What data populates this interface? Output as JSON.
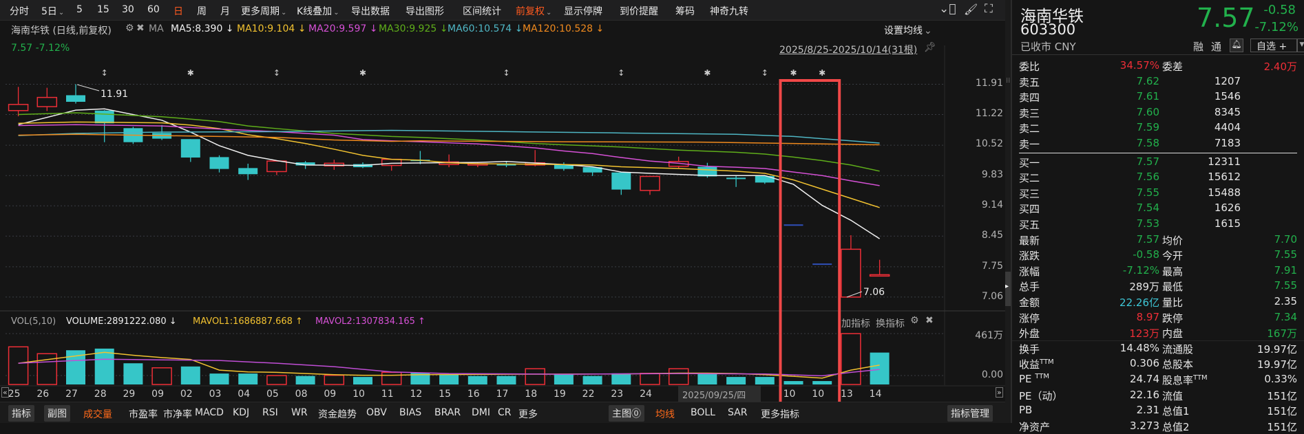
{
  "toolbar": {
    "items": [
      "分时",
      "5日",
      "5",
      "15",
      "30",
      "60",
      "日",
      "周",
      "月",
      "更多周期",
      "K线叠加",
      "导出数据",
      "导出图形",
      "区间统计",
      "前复权",
      "显示停牌",
      "到价提醒",
      "筹码",
      "神奇九转"
    ],
    "active": [
      "日",
      "前复权"
    ]
  },
  "legend": {
    "title": "海南华铁 (日线,前复权)",
    "ma_label": "MA",
    "ma5": "MA5:8.390 ↓",
    "ma10": "MA10:9.104 ↓",
    "ma20": "MA20:9.597 ↓",
    "ma30": "MA30:9.925 ↓",
    "ma60": "MA60:10.574 ↓",
    "ma120": "MA120:10.528 ↓",
    "set_ma": "设置均线",
    "price_change": "7.57  -7.12%",
    "range": "2025/8/25-2025/10/14(31根)"
  },
  "colors": {
    "up": "#ee2e37",
    "down": "#36c6c8",
    "limit": "#2f4fb8",
    "ma5": "#f0f0f0",
    "ma10": "#f2c230",
    "ma20": "#d651d6",
    "ma30": "#5fae1a",
    "ma60": "#4fb6c4",
    "ma120": "#f08a1e",
    "mavol1": "#f2c230",
    "mavol2": "#c04ed6",
    "highlight": "#f04848"
  },
  "vol_legend": {
    "name": "VOL(5,10)",
    "volume": "VOLUME:2891222.080 ↓",
    "mavol1": "MAVOL1:1686887.668 ↑",
    "mavol2": "MAVOL2:1307834.165 ↑",
    "add": "加指标",
    "switch": "换指标"
  },
  "annotations": {
    "high": "11.91",
    "low": "7.06"
  },
  "tooltip_date": "2025/09/25/四",
  "chart_data": {
    "type": "candlestick",
    "price_axis": [
      "11.91",
      "11.22",
      "10.52",
      "9.83",
      "9.14",
      "8.45",
      "7.75",
      "7.06"
    ],
    "price_range": [
      7.06,
      11.91
    ],
    "vol_axis": [
      "461万",
      "0.00"
    ],
    "vol_max": 461,
    "date_labels": [
      "25",
      "26",
      "27",
      "28",
      "29",
      "09",
      "02",
      "03",
      "04",
      "05",
      "08",
      "09",
      "10",
      "11",
      "12",
      "15",
      "16",
      "17",
      "18",
      "19",
      "22",
      "23",
      "24",
      "",
      "",
      "",
      "",
      "10",
      "10",
      "13",
      "14"
    ],
    "ohlcv": [
      [
        11.31,
        11.85,
        11.18,
        11.45,
        341
      ],
      [
        11.4,
        11.83,
        11.3,
        11.61,
        279
      ],
      [
        11.66,
        11.91,
        11.47,
        11.51,
        310
      ],
      [
        11.31,
        11.32,
        10.59,
        11.02,
        325
      ],
      [
        10.91,
        10.94,
        10.55,
        10.59,
        192
      ],
      [
        10.8,
        10.98,
        10.64,
        10.67,
        151
      ],
      [
        10.66,
        10.66,
        10.14,
        10.24,
        163
      ],
      [
        10.25,
        10.29,
        9.9,
        9.98,
        99
      ],
      [
        10.0,
        10.1,
        9.73,
        9.86,
        99
      ],
      [
        9.92,
        10.16,
        9.84,
        10.16,
        81
      ],
      [
        10.13,
        10.16,
        9.98,
        10.06,
        77
      ],
      [
        10.05,
        10.19,
        9.96,
        10.11,
        83
      ],
      [
        10.09,
        10.13,
        10.0,
        10.02,
        68
      ],
      [
        10.06,
        10.2,
        9.94,
        10.2,
        110
      ],
      [
        10.19,
        10.39,
        10.09,
        10.16,
        105
      ],
      [
        10.08,
        10.31,
        10.02,
        10.14,
        93
      ],
      [
        10.08,
        10.13,
        10.02,
        10.1,
        77
      ],
      [
        10.09,
        10.16,
        10.02,
        10.06,
        77
      ],
      [
        10.07,
        10.41,
        10.04,
        10.12,
        143
      ],
      [
        10.08,
        10.13,
        9.94,
        9.98,
        93
      ],
      [
        10.02,
        10.02,
        9.82,
        9.9,
        77
      ],
      [
        9.9,
        9.9,
        9.39,
        9.51,
        101
      ],
      [
        9.49,
        9.81,
        9.39,
        9.81,
        101
      ],
      [
        10.04,
        10.26,
        10.0,
        10.15,
        143
      ],
      [
        10.03,
        10.12,
        9.78,
        9.81,
        95
      ],
      [
        9.78,
        9.83,
        9.57,
        9.75,
        68
      ],
      [
        9.82,
        9.82,
        9.64,
        9.67,
        68
      ],
      [
        8.7,
        8.7,
        8.7,
        8.7,
        31
      ],
      [
        7.81,
        7.81,
        7.81,
        7.81,
        31
      ],
      [
        7.06,
        8.47,
        7.06,
        8.15,
        461
      ],
      [
        7.55,
        7.91,
        7.55,
        7.57,
        289
      ]
    ],
    "ma_lines": [
      {
        "name": "MA5",
        "color": "#f0f0f0",
        "points": [
          [
            0,
            10.99
          ],
          [
            2,
            11.32
          ],
          [
            3,
            11.35
          ],
          [
            5,
            11.09
          ],
          [
            6,
            10.82
          ],
          [
            7,
            10.51
          ],
          [
            8,
            10.29
          ],
          [
            9,
            10.17
          ],
          [
            10,
            10.07
          ],
          [
            12,
            10.06
          ],
          [
            13,
            10.11
          ],
          [
            16,
            10.13
          ],
          [
            17,
            10.15
          ],
          [
            19,
            10.08
          ],
          [
            20,
            10.03
          ],
          [
            21,
            9.91
          ],
          [
            22,
            9.88
          ],
          [
            24,
            9.83
          ],
          [
            26,
            9.83
          ],
          [
            27,
            9.63
          ],
          [
            28,
            9.15
          ],
          [
            29,
            8.81
          ],
          [
            30,
            8.39
          ]
        ]
      },
      {
        "name": "MA10",
        "color": "#f2c230",
        "points": [
          [
            0,
            11.02
          ],
          [
            2,
            11.05
          ],
          [
            5,
            11.03
          ],
          [
            6,
            10.98
          ],
          [
            7,
            10.9
          ],
          [
            8,
            10.76
          ],
          [
            9,
            10.67
          ],
          [
            10,
            10.56
          ],
          [
            11,
            10.43
          ],
          [
            12,
            10.29
          ],
          [
            13,
            10.2
          ],
          [
            14,
            10.18
          ],
          [
            15,
            10.12
          ],
          [
            16,
            10.1
          ],
          [
            19,
            10.08
          ],
          [
            20,
            10.07
          ],
          [
            21,
            10.03
          ],
          [
            22,
            10.01
          ],
          [
            23,
            9.99
          ],
          [
            24,
            9.96
          ],
          [
            25,
            9.93
          ],
          [
            26,
            9.88
          ],
          [
            27,
            9.73
          ],
          [
            28,
            9.52
          ],
          [
            29,
            9.31
          ],
          [
            30,
            9.1
          ]
        ]
      },
      {
        "name": "MA20",
        "color": "#d651d6",
        "points": [
          [
            0,
            10.97
          ],
          [
            2,
            10.99
          ],
          [
            5,
            10.96
          ],
          [
            7,
            10.89
          ],
          [
            9,
            10.83
          ],
          [
            11,
            10.75
          ],
          [
            12,
            10.65
          ],
          [
            13,
            10.62
          ],
          [
            14,
            10.6
          ],
          [
            16,
            10.55
          ],
          [
            18,
            10.46
          ],
          [
            19,
            10.39
          ],
          [
            20,
            10.33
          ],
          [
            21,
            10.24
          ],
          [
            22,
            10.16
          ],
          [
            23,
            10.11
          ],
          [
            24,
            10.04
          ],
          [
            25,
            10.02
          ],
          [
            26,
            9.99
          ],
          [
            27,
            9.91
          ],
          [
            28,
            9.83
          ],
          [
            29,
            9.71
          ],
          [
            30,
            9.6
          ]
        ]
      },
      {
        "name": "MA30",
        "color": "#5fae1a",
        "points": [
          [
            0,
            11.22
          ],
          [
            2,
            11.26
          ],
          [
            5,
            11.17
          ],
          [
            7,
            11.06
          ],
          [
            8,
            10.96
          ],
          [
            9,
            10.9
          ],
          [
            11,
            10.79
          ],
          [
            13,
            10.72
          ],
          [
            14,
            10.7
          ],
          [
            16,
            10.64
          ],
          [
            18,
            10.56
          ],
          [
            19,
            10.53
          ],
          [
            21,
            10.48
          ],
          [
            23,
            10.41
          ],
          [
            25,
            10.36
          ],
          [
            26,
            10.32
          ],
          [
            27,
            10.25
          ],
          [
            28,
            10.17
          ],
          [
            29,
            10.07
          ],
          [
            30,
            9.93
          ]
        ]
      },
      {
        "name": "MA60",
        "color": "#4fb6c4",
        "points": [
          [
            0,
            10.74
          ],
          [
            2,
            10.79
          ],
          [
            5,
            10.82
          ],
          [
            9,
            10.83
          ],
          [
            13,
            10.86
          ],
          [
            17,
            10.83
          ],
          [
            21,
            10.8
          ],
          [
            25,
            10.77
          ],
          [
            27,
            10.72
          ],
          [
            28,
            10.67
          ],
          [
            29,
            10.62
          ],
          [
            30,
            10.57
          ]
        ]
      },
      {
        "name": "MA120",
        "color": "#f08a1e",
        "points": [
          [
            0,
            10.75
          ],
          [
            2,
            10.77
          ],
          [
            5,
            10.74
          ],
          [
            9,
            10.7
          ],
          [
            11,
            10.64
          ],
          [
            13,
            10.61
          ],
          [
            14,
            10.62
          ],
          [
            19,
            10.6
          ],
          [
            24,
            10.59
          ],
          [
            27,
            10.56
          ],
          [
            29,
            10.54
          ],
          [
            30,
            10.53
          ]
        ]
      }
    ],
    "vol_ma_lines": [
      {
        "name": "MAVOL1",
        "color": "#f2c230",
        "points": [
          [
            0,
            192
          ],
          [
            3,
            291
          ],
          [
            4,
            265
          ],
          [
            5,
            244
          ],
          [
            6,
            227
          ],
          [
            7,
            130
          ],
          [
            8,
            114
          ],
          [
            9,
            110
          ],
          [
            11,
            89
          ],
          [
            12,
            83
          ],
          [
            13,
            83
          ],
          [
            14,
            89
          ],
          [
            17,
            93
          ],
          [
            21,
            95
          ],
          [
            23,
            103
          ],
          [
            24,
            103
          ],
          [
            25,
            99
          ],
          [
            26,
            89
          ],
          [
            27,
            74
          ],
          [
            28,
            58
          ],
          [
            29,
            130
          ],
          [
            30,
            176
          ]
        ]
      },
      {
        "name": "MAVOL2",
        "color": "#c04ed6",
        "points": [
          [
            0,
            192
          ],
          [
            2,
            217
          ],
          [
            3,
            229
          ],
          [
            5,
            223
          ],
          [
            7,
            217
          ],
          [
            9,
            192
          ],
          [
            11,
            161
          ],
          [
            13,
            114
          ],
          [
            15,
            99
          ],
          [
            19,
            93
          ],
          [
            23,
            99
          ],
          [
            26,
            95
          ],
          [
            28,
            79
          ],
          [
            29,
            110
          ],
          [
            30,
            136
          ]
        ]
      }
    ],
    "markers": [
      {
        "index": 3,
        "type": "↕"
      },
      {
        "index": 6,
        "type": "✱"
      },
      {
        "index": 9,
        "type": "↕"
      },
      {
        "index": 12,
        "type": "✱"
      },
      {
        "index": 17,
        "type": "↕"
      },
      {
        "index": 21,
        "type": "↕"
      },
      {
        "index": 24,
        "type": "✱"
      },
      {
        "index": 26,
        "type": "↕"
      },
      {
        "index": 27,
        "type": "✱"
      },
      {
        "index": 28,
        "type": "✱"
      }
    ],
    "highlight_range": [
      27,
      28
    ]
  },
  "quote": {
    "name": "海南华铁",
    "code": "603300",
    "status": "已收市 CNY",
    "price": "7.57",
    "change": "-0.58",
    "pct": "-7.12%",
    "margin": "融",
    "connect": "通",
    "watchlist": "自选 +"
  },
  "order_book": {
    "ratio": {
      "l1": "委比",
      "v1": "34.57%",
      "l2": "委差",
      "v2": "2.40万"
    },
    "asks": [
      [
        "卖五",
        "7.62",
        "1207"
      ],
      [
        "卖四",
        "7.61",
        "1546"
      ],
      [
        "卖三",
        "7.60",
        "8345"
      ],
      [
        "卖二",
        "7.59",
        "4404"
      ],
      [
        "卖一",
        "7.58",
        "7183"
      ]
    ],
    "bids": [
      [
        "买一",
        "7.57",
        "12311"
      ],
      [
        "买二",
        "7.56",
        "15612"
      ],
      [
        "买三",
        "7.55",
        "15488"
      ],
      [
        "买四",
        "7.54",
        "1626"
      ],
      [
        "买五",
        "7.53",
        "1615"
      ]
    ]
  },
  "stats": [
    {
      "l1": "最新",
      "v1": "7.57",
      "c1": "g",
      "l2": "均价",
      "v2": "7.70",
      "c2": "g"
    },
    {
      "l1": "涨跌",
      "v1": "-0.58",
      "c1": "g",
      "l2": "今开",
      "v2": "7.55",
      "c2": "g"
    },
    {
      "l1": "涨幅",
      "v1": "-7.12%",
      "c1": "g",
      "l2": "最高",
      "v2": "7.91",
      "c2": "g"
    },
    {
      "l1": "总手",
      "v1": "289万",
      "c1": "w",
      "l2": "最低",
      "v2": "7.55",
      "c2": "g"
    },
    {
      "l1": "金额",
      "v1": "22.26亿",
      "c1": "c",
      "l2": "量比",
      "v2": "2.35",
      "c2": "w"
    },
    {
      "l1": "涨停",
      "v1": "8.97",
      "c1": "r",
      "l2": "跌停",
      "v2": "7.34",
      "c2": "g"
    },
    {
      "l1": "外盘",
      "v1": "123万",
      "c1": "r",
      "l2": "内盘",
      "v2": "167万",
      "c2": "g"
    },
    {
      "l1": "换手",
      "v1": "14.48%",
      "c1": "w",
      "l2": "流通股",
      "v2": "19.97亿",
      "c2": "w"
    },
    {
      "l1": "收益",
      "s1": "TTM",
      "v1": "0.306",
      "c1": "w",
      "l2": "总股本",
      "v2": "19.97亿",
      "c2": "w"
    },
    {
      "l1": "PE ",
      "s1": "TTM",
      "v1": "24.74",
      "c1": "w",
      "l2": "股息率",
      "s2": "TTM",
      "v2": "0.33%",
      "c2": "w"
    },
    {
      "l1": "PE（动）",
      "v1": "22.16",
      "c1": "w",
      "l2": "流值",
      "v2": "151亿",
      "c2": "w"
    },
    {
      "l1": "PB",
      "v1": "2.31",
      "c1": "w",
      "l2": "总值1",
      "v2": "151亿",
      "c2": "w"
    },
    {
      "l1": "净资产",
      "v1": "3.273",
      "c1": "w",
      "l2": "总值2",
      "v2": "151亿",
      "c2": "w"
    }
  ],
  "bottombar": {
    "items": [
      "指标",
      "副图",
      "成交量",
      "市盈率",
      "市净率",
      "MACD",
      "KDJ",
      "RSI",
      "WR",
      "资金趋势",
      "OBV",
      "BIAS",
      "BRAR",
      "DMI",
      "CR",
      "更多",
      "主图⓪",
      "均线",
      "BOLL",
      "SAR",
      "更多指标",
      "指标管理"
    ]
  }
}
